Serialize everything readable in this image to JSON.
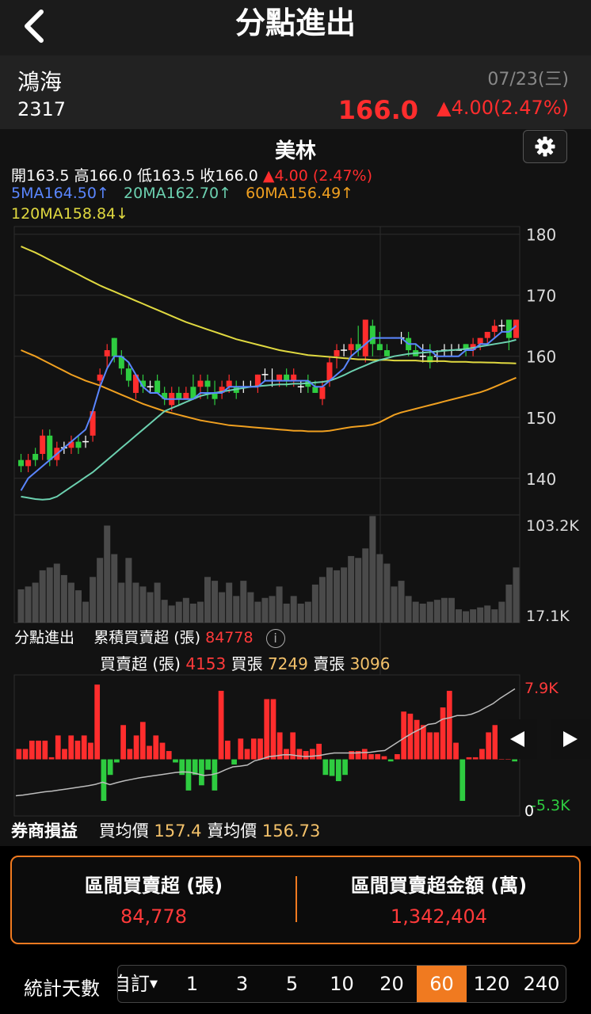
{
  "header": {
    "title": "分點進出"
  },
  "stock": {
    "name": "鴻海",
    "code": "2317",
    "date": "07/23(三)",
    "price": "166.0",
    "change": "▲4.00(2.47%)"
  },
  "broker": {
    "name": "美林"
  },
  "ohlc": {
    "open_label": "開",
    "open": "163.5",
    "high_label": "高",
    "high": "166.0",
    "low_label": "低",
    "low": "163.5",
    "close_label": "收",
    "close": "166.0",
    "change": "▲4.00 (2.47%)"
  },
  "ma": {
    "ma5": "5MA164.50↑",
    "ma20": "20MA162.70↑",
    "ma60": "60MA156.49↑",
    "ma120": "120MA158.84↓"
  },
  "colors": {
    "up": "#ff2d2d",
    "down": "#2ecc40",
    "ma5": "#5a86ff",
    "ma20": "#6cd1b0",
    "ma60": "#f0a020",
    "ma120": "#e0d940",
    "accent": "#f07a20"
  },
  "chart_data": [
    {
      "type": "candlestick",
      "y_ticks": [
        "180",
        "170",
        "160",
        "150",
        "140"
      ],
      "ylim": [
        134,
        181
      ],
      "ohlc": [
        [
          143,
          144,
          141,
          142
        ],
        [
          142,
          144,
          141,
          143
        ],
        [
          144,
          145,
          142,
          143
        ],
        [
          144,
          148,
          143,
          147
        ],
        [
          147,
          148,
          142,
          143
        ],
        [
          143,
          146,
          142,
          145
        ],
        [
          145,
          146,
          144,
          145
        ],
        [
          145,
          147,
          144,
          146
        ],
        [
          146,
          147,
          144,
          145
        ],
        [
          146,
          147,
          145,
          146
        ],
        [
          147,
          151,
          146,
          151
        ],
        [
          156,
          158,
          155,
          157
        ],
        [
          160,
          162,
          158,
          161
        ],
        [
          163,
          163,
          159,
          160
        ],
        [
          160,
          161,
          157,
          158
        ],
        [
          158,
          159,
          155,
          156
        ],
        [
          154,
          157,
          153,
          157
        ],
        [
          156,
          157,
          154,
          155
        ],
        [
          155,
          156,
          154,
          155
        ],
        [
          156,
          157,
          154,
          154
        ],
        [
          154,
          155,
          152,
          153
        ],
        [
          152,
          155,
          151,
          154
        ],
        [
          154,
          155,
          152,
          153
        ],
        [
          153,
          155,
          153,
          154
        ],
        [
          155,
          157,
          153,
          153
        ],
        [
          155,
          157,
          153,
          156
        ],
        [
          156,
          157,
          153,
          155
        ],
        [
          154,
          156,
          152,
          153
        ],
        [
          154,
          156,
          153,
          155
        ],
        [
          155,
          157,
          154,
          156
        ],
        [
          155,
          156,
          153,
          154
        ],
        [
          155,
          156,
          154,
          155
        ],
        [
          155,
          156,
          155,
          155
        ],
        [
          155,
          157,
          154,
          157
        ],
        [
          157,
          158,
          156,
          157
        ],
        [
          156,
          158,
          155,
          156
        ],
        [
          156,
          157,
          155,
          157
        ],
        [
          157,
          158,
          155,
          156
        ],
        [
          156,
          158,
          155,
          157
        ],
        [
          155,
          156,
          154,
          155
        ],
        [
          156,
          157,
          154,
          155
        ],
        [
          155,
          156,
          154,
          154
        ],
        [
          153,
          156,
          152,
          155
        ],
        [
          156,
          160,
          155,
          159
        ],
        [
          160,
          162,
          158,
          161
        ],
        [
          161,
          162,
          160,
          161
        ],
        [
          161,
          163,
          160,
          162
        ],
        [
          162,
          165,
          160,
          161
        ],
        [
          160,
          166,
          159,
          166
        ],
        [
          165,
          166,
          160,
          162
        ],
        [
          162,
          164,
          161,
          161
        ],
        [
          161,
          162,
          160,
          160
        ],
        [
          163,
          163,
          163,
          163
        ],
        [
          163,
          164,
          162,
          163
        ],
        [
          163,
          164,
          160,
          161
        ],
        [
          161,
          162,
          160,
          160
        ],
        [
          160,
          162,
          159,
          160
        ],
        [
          160,
          162,
          158,
          159
        ],
        [
          160,
          161,
          159,
          160
        ],
        [
          161,
          162,
          160,
          161
        ],
        [
          161,
          162,
          160,
          161
        ],
        [
          161,
          162,
          161,
          161
        ],
        [
          162,
          162,
          160,
          161
        ],
        [
          161,
          163,
          160,
          162
        ],
        [
          162,
          163,
          161,
          163
        ],
        [
          163,
          164,
          162,
          164
        ],
        [
          164,
          166,
          163,
          165
        ],
        [
          165,
          166,
          164,
          165
        ],
        [
          166,
          166,
          161,
          163
        ],
        [
          163,
          166,
          163,
          166
        ]
      ],
      "ma5": [
        138,
        140,
        141,
        142,
        143,
        144,
        145,
        146,
        147,
        148,
        151,
        155,
        158,
        160,
        160,
        159,
        157,
        155,
        154,
        154,
        153,
        153,
        153,
        153,
        153,
        154,
        154,
        154,
        154,
        155,
        155,
        155,
        155,
        155,
        156,
        156,
        156,
        156,
        156,
        156,
        156,
        155,
        155,
        156,
        157,
        158,
        160,
        161,
        162,
        163,
        163,
        163,
        163,
        163,
        162,
        162,
        161,
        161,
        160,
        160,
        160,
        160,
        161,
        161,
        162,
        162,
        163,
        164,
        164,
        165
      ],
      "ma20": [
        137,
        136.8,
        136.6,
        136.5,
        136.6,
        137,
        137.8,
        138.6,
        139.4,
        140.2,
        141,
        142,
        143,
        144,
        145,
        146,
        147,
        148,
        149,
        150,
        151,
        151.5,
        152,
        152.5,
        153,
        153.5,
        153.8,
        154,
        154.2,
        154.4,
        154.6,
        154.8,
        155,
        155.1,
        155.2,
        155.3,
        155.4,
        155.4,
        155.5,
        155.5,
        155.6,
        155.7,
        155.8,
        156,
        156.4,
        156.9,
        157.5,
        158,
        158.5,
        159,
        159.4,
        159.7,
        160,
        160.2,
        160.4,
        160.5,
        160.6,
        160.7,
        160.8,
        160.9,
        161,
        161.1,
        161.2,
        161.4,
        161.6,
        161.8,
        162,
        162.2,
        162.4,
        162.7
      ],
      "ma60": [
        161,
        160.5,
        160,
        159.4,
        158.8,
        158.2,
        157.6,
        157,
        156.5,
        156,
        155.6,
        155.2,
        154.7,
        154.2,
        153.7,
        153.2,
        152.7,
        152.2,
        151.8,
        151.4,
        151,
        150.7,
        150.4,
        150.1,
        149.8,
        149.5,
        149.3,
        149.1,
        148.9,
        148.7,
        148.6,
        148.5,
        148.4,
        148.3,
        148.2,
        148.1,
        148,
        147.9,
        147.8,
        147.8,
        147.7,
        147.7,
        147.7,
        147.8,
        148,
        148.2,
        148.4,
        148.5,
        148.6,
        148.8,
        149.2,
        149.8,
        150.4,
        150.8,
        151.1,
        151.4,
        151.7,
        152,
        152.3,
        152.6,
        152.9,
        153.2,
        153.5,
        153.8,
        154.1,
        154.5,
        155,
        155.5,
        156,
        156.49
      ],
      "ma120": [
        178,
        177.5,
        177,
        176.4,
        175.8,
        175.2,
        174.6,
        174,
        173.4,
        172.8,
        172.2,
        171.6,
        171.1,
        170.6,
        170.1,
        169.6,
        169.1,
        168.6,
        168.1,
        167.6,
        167.1,
        166.6,
        166.1,
        165.6,
        165.2,
        164.8,
        164.4,
        164,
        163.6,
        163.2,
        162.8,
        162.5,
        162.2,
        161.9,
        161.6,
        161.3,
        161,
        160.8,
        160.6,
        160.4,
        160.2,
        160.1,
        160,
        159.9,
        159.8,
        159.7,
        159.6,
        159.5,
        159.5,
        159.4,
        159.4,
        159.4,
        159.3,
        159.3,
        159.3,
        159.3,
        159.2,
        159.2,
        159.2,
        159.2,
        159.1,
        159.1,
        159.1,
        159.0,
        159.0,
        158.98,
        158.95,
        158.9,
        158.87,
        158.84
      ]
    },
    {
      "type": "bar",
      "name": "volume",
      "y_ticks": [
        "103.2K",
        "17.1K"
      ],
      "ylim": [
        0,
        103.2
      ],
      "values": [
        35,
        38,
        42,
        55,
        58,
        62,
        50,
        42,
        34,
        22,
        48,
        68,
        102,
        72,
        42,
        68,
        42,
        38,
        32,
        42,
        24,
        18,
        22,
        26,
        20,
        22,
        48,
        44,
        32,
        42,
        28,
        44,
        32,
        22,
        26,
        28,
        38,
        20,
        28,
        20,
        22,
        40,
        48,
        58,
        55,
        58,
        70,
        68,
        78,
        112,
        72,
        62,
        38,
        44,
        28,
        22,
        20,
        22,
        24,
        26,
        26,
        14,
        12,
        14,
        16,
        18,
        14,
        22,
        40,
        58
      ]
    },
    {
      "type": "bar",
      "name": "buy-sell",
      "y_ticks": [
        "7.9K",
        "-5.3K",
        "0"
      ],
      "ylim": [
        -5.3,
        7.9
      ],
      "values": [
        1.0,
        1.0,
        1.8,
        1.8,
        1.8,
        0.2,
        2.3,
        1.0,
        2.3,
        1.8,
        2.3,
        1.6,
        7.2,
        -4.0,
        -1.5,
        -0.3,
        3.3,
        1.0,
        2.3,
        3.6,
        1.3,
        2.3,
        1.6,
        0.8,
        -0.3,
        -1.5,
        -3.0,
        -1.5,
        -2.5,
        -1.0,
        -3.0,
        6.6,
        1.8,
        -0.5,
        2.0,
        1.0,
        2.0,
        2.0,
        5.8,
        5.8,
        2.6,
        1.0,
        2.6,
        1.0,
        0.8,
        1.0,
        1.5,
        -1.5,
        -1.6,
        -2.1,
        -1.5,
        0.8,
        0.8,
        1.0,
        0.5,
        0.5,
        0.3,
        -0.2,
        0.5,
        4.6,
        4.4,
        3.8,
        3.3,
        2.6,
        2.6,
        5.0,
        6.6,
        1.6,
        -4.0,
        0.2,
        0.2,
        1.0,
        2.6,
        3.3,
        3.3,
        3.3,
        -0.2
      ],
      "cumulative": [
        3,
        3.2,
        3.5,
        3.8,
        4.1,
        4.3,
        4.6,
        4.9,
        5.2,
        5.5,
        5.8,
        6.2,
        6.8,
        6.1,
        6.7,
        7.2,
        7.6,
        8,
        8.3,
        8.6,
        8.9,
        9.2,
        9.5,
        9.7,
        9.6,
        9.2,
        8.7,
        8.9,
        9.4,
        10.3,
        11.1,
        11.3,
        11.6,
        12.8,
        13.3,
        14,
        14.2,
        14.5,
        14.5,
        14.2,
        14,
        14.1,
        14.3,
        14.7,
        15,
        15,
        15,
        15,
        15.1,
        15.2,
        15.5,
        15.7,
        17,
        18.3,
        19.6,
        20.8,
        21.8,
        23,
        23.3,
        24.5,
        24.9,
        25.5,
        25.5,
        25.9,
        26.7,
        27.8,
        28.9,
        30.4,
        31.7,
        33
      ]
    }
  ],
  "volume_ticks": {
    "top": "103.2K",
    "bottom": "17.1K"
  },
  "bs_ticks": {
    "top": "7.9K",
    "bottom": "-5.3K",
    "zero": "0"
  },
  "bs_panel": {
    "title": "分點進出",
    "cum_label": "累積買賣超 (張)",
    "cum_value": "84778",
    "net_label": "買賣超 (張)",
    "net_value": "4153",
    "buy_label": "買張",
    "buy_value": "7249",
    "sell_label": "賣張",
    "sell_value": "3096"
  },
  "broker_profit": {
    "title": "券商損益",
    "buy_avg_label": "買均價",
    "buy_avg": "157.4",
    "sell_avg_label": "賣均價",
    "sell_avg": "156.73"
  },
  "summary": {
    "net_label": "區間買賣超 (張)",
    "net_value": "84,778",
    "amount_label": "區間買賣超金額 (萬)",
    "amount_value": "1,342,404"
  },
  "days": {
    "label": "統計天數",
    "custom": "自訂",
    "options": [
      "1",
      "3",
      "5",
      "10",
      "20",
      "60",
      "120",
      "240"
    ],
    "selected": "60"
  }
}
